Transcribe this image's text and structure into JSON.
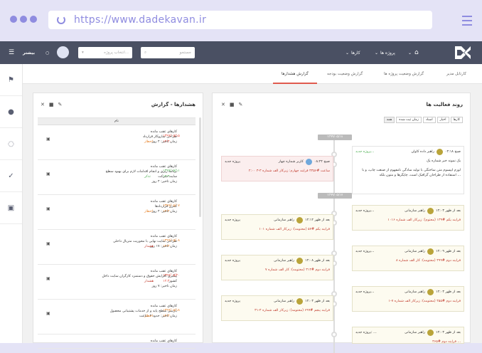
{
  "browser": {
    "url": "https://www.dadekavan.ir"
  },
  "topnav": {
    "more": "بیشتر",
    "search_placeholder": "جستجو",
    "project_select_placeholder": "انتخاب پروژه...",
    "menu_projects": "پروژه ها",
    "menu_tasks": "کارها"
  },
  "tabs": [
    "کارتابل مدیر",
    "گزارش وضعیت پروژه ها",
    "گزارش وضعیت بودجه",
    "گزارش هشدارها"
  ],
  "activity": {
    "title": "روند فعالیت ها",
    "filters": [
      "کارها",
      "اخبار",
      "اسناد",
      "زمان ثبت شده",
      "همه"
    ],
    "dates": [
      "۱۳۹۹/۰۵/۱۸",
      "۱۳۹۹/۰۵/۱۷"
    ],
    "cards": [
      {
        "time": "۰۴:۱۸ صبح",
        "user": "راهبر داده کاوان",
        "tag": "پروژه جدید...",
        "title": "یک نمونه خبر شماره یک",
        "body": "لورم ایپسوم متن ساختگی با تولید سادگی نامفهوم از صنعت چاپ، و با استفاده از طراحان گرافیک است، چاپگرها و متون بلکه ..."
      },
      {
        "time": "۰۸:۲۴ صبح",
        "user": "کاربر شماره چهار",
        "tag": "پروژه جدید",
        "title": "۲:۰۰ ساعت #۴۳۵۶ فرایند چهارم: زیرکار الف شماره ۳-۳"
      },
      {
        "time": "۱۲:۰۳ بعد از ظهر",
        "user": "راهبر سازمانی",
        "tag": "پروژه جدید...",
        "title": "فرایند یکم #۱۳۹ (محتوم): زیرکار الف شماره ۱۰۱۶"
      },
      {
        "time": "۱۲:۱۲ بعد از ظهر",
        "user": "راهبر سازمانی",
        "tag": "پروژه جدید",
        "title": "فرایند یکم #۵۷ (محتومه): زیرکار الف شماره ۱۰۱"
      },
      {
        "time": "۱۲:۰۹ بعد از ظهر",
        "user": "راهبر سازمانی",
        "tag": "پروژه جدید...",
        "title": "فرایند دوم #۴۹۹ (محتومه): کار الف شماره ۸"
      },
      {
        "time": "۱۲:۰۸ بعد از ظهر",
        "user": "راهبر سازمانی",
        "tag": "پروژه جدید",
        "title": "فرایند دوم #۳۱۴ (محتومه): کار الف شماره ۷"
      },
      {
        "time": "۱۲:۰۳ بعد از ظهر",
        "user": "راهبر سازمانی",
        "tag": "پروژه جدید...",
        "title": "فرایند دوم #۴۵۵ (محتومه): زیرکار الف شماره ۷-۱"
      },
      {
        "time": "۱۲:۰۳ بعد از ظهر",
        "user": "راهبر سازمانی",
        "tag": "پروژه جدید",
        "title": "فرایند پنجم #۶۹۹ (محتومه): زیرکار الف شماره ۴-۳۱"
      },
      {
        "time": "۱۲:۰۳ بعد از ظهر",
        "user": "راهبر سازمانی",
        "tag": "پروژه جدید: ...",
        "title": "فرایند دوم #۴۶۵ ..."
      }
    ]
  },
  "alerts": {
    "title": "هشدارها - گزارش",
    "col_name": "نام",
    "rows": [
      {
        "l1": "کارهای عقب مانده",
        "l2": "طراحی سازوکار قرارداد",
        "l3": "زمان تاخیر: ۴ روز",
        "status": "اخطار",
        "date1": "۱۳۹۹/۰۵/۱۵",
        "date2": "۱۲:۳۰"
      },
      {
        "l1": "کارهای عقب مانده",
        "l2": "برنامه ریزی و انجام اقدامات لازم برای بهبود سطح سایت شرکت",
        "l3": "زمان تاخیر: ۴ روز",
        "status": "تذکر",
        "date1": "۱۳۹۹/۰۵/۱۱",
        "date2": "۱۲:۳۰"
      },
      {
        "l1": "کارهای عقب مانده",
        "l2": "کنترل قراردادها",
        "l3": "زمان تاخیر: ۴ روز",
        "status": "اخطار",
        "date1": "۱۳۹۹/۰۵/۰۷",
        "date2": "۱۲:۳۰"
      },
      {
        "l1": "کارهای عقب مانده",
        "l2": "طراحی سایت نهایی با محوریت متریال داخلی",
        "l3": "زمان تاخیر: ۱۷ روز",
        "status": "هشدار",
        "date1": "۱۳۹۹/۰۵/۰۸",
        "date2": "۱۲:۳۰"
      },
      {
        "l1": "کارهای عقب مانده",
        "l2": "پیگیری افزایش حقوق و دستمزد کارگران سایت داخل کشور",
        "l3": "زمان تاخیر: ۷ روز",
        "status": "هشدار",
        "date1": "۱۳۹۹/۰۵/۲۰",
        "date2": "۱۲:۳۰"
      },
      {
        "l1": "کارهای عقب مانده",
        "l2": "بازبینی سطح پایه و از خدمات پشتیبانی محصول",
        "l3": "زمان تاخیر: حدود ۴ ساعت",
        "status": "اخطار",
        "date1": "۱۳۹۹/۰۵/۱۸",
        "date2": "۱۲:۳۰"
      },
      {
        "l1": "کارهای عقب مانده",
        "l2": "",
        "l3": "",
        "status": "",
        "date1": "",
        "date2": ""
      }
    ]
  },
  "colors": {
    "accent": "#e05a4e",
    "nav": "#4a5063",
    "frame": "#8f8ce0"
  }
}
